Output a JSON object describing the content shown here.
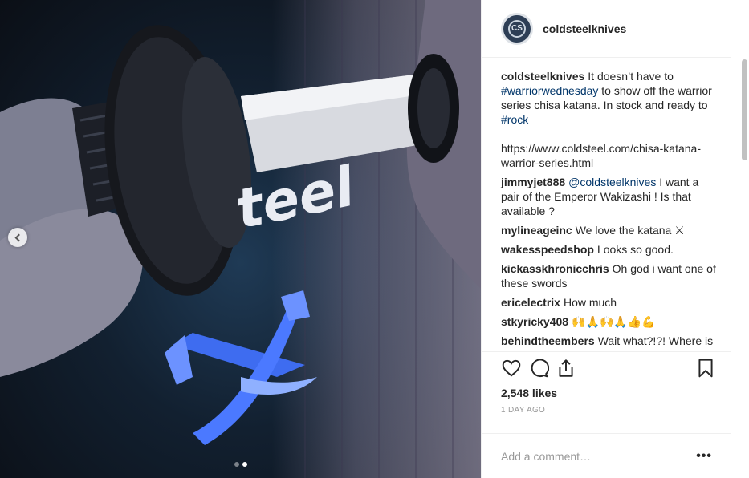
{
  "post": {
    "username": "coldsteelknives",
    "avatar_text": "CS",
    "caption": {
      "user": "coldsteelknives",
      "part1": "It doesn’t have to",
      "tag1": "#warriorwednesday",
      "part2": "to show off the warrior series chisa katana. In stock and ready to",
      "tag2": "#rock",
      "url": "https://www.coldsteel.com/chisa-katana-warrior-series.html"
    },
    "comments": [
      {
        "user": "jimmyjet888",
        "mention": "@coldsteelknives",
        "text": "I want a pair of the Emperor Wakizashi ! Is that available ?"
      },
      {
        "user": "mylineageinc",
        "text": "We love the katana ⚔"
      },
      {
        "user": "wakesspeedshop",
        "text": "Looks so good."
      },
      {
        "user": "kickasskhronicchris",
        "text": "Oh god i want one of these swords"
      },
      {
        "user": "ericelectrix",
        "text": "How much"
      },
      {
        "user": "stkyricky408",
        "text": "🙌🙏🙌🙏👍💪"
      },
      {
        "user": "behindtheembers",
        "text": "Wait what?!?! Where is the link for price!!!!??? Would look sick"
      }
    ],
    "likes": "2,548 likes",
    "date": "1 DAY AGO",
    "add_comment_placeholder": "Add a comment…",
    "more_label": "•••"
  },
  "icons": {
    "like": "heart-icon",
    "comment": "comment-icon",
    "share": "share-icon",
    "save": "bookmark-icon",
    "prev": "chevron-left-icon"
  },
  "carousel": {
    "count": 2,
    "active": 2
  }
}
